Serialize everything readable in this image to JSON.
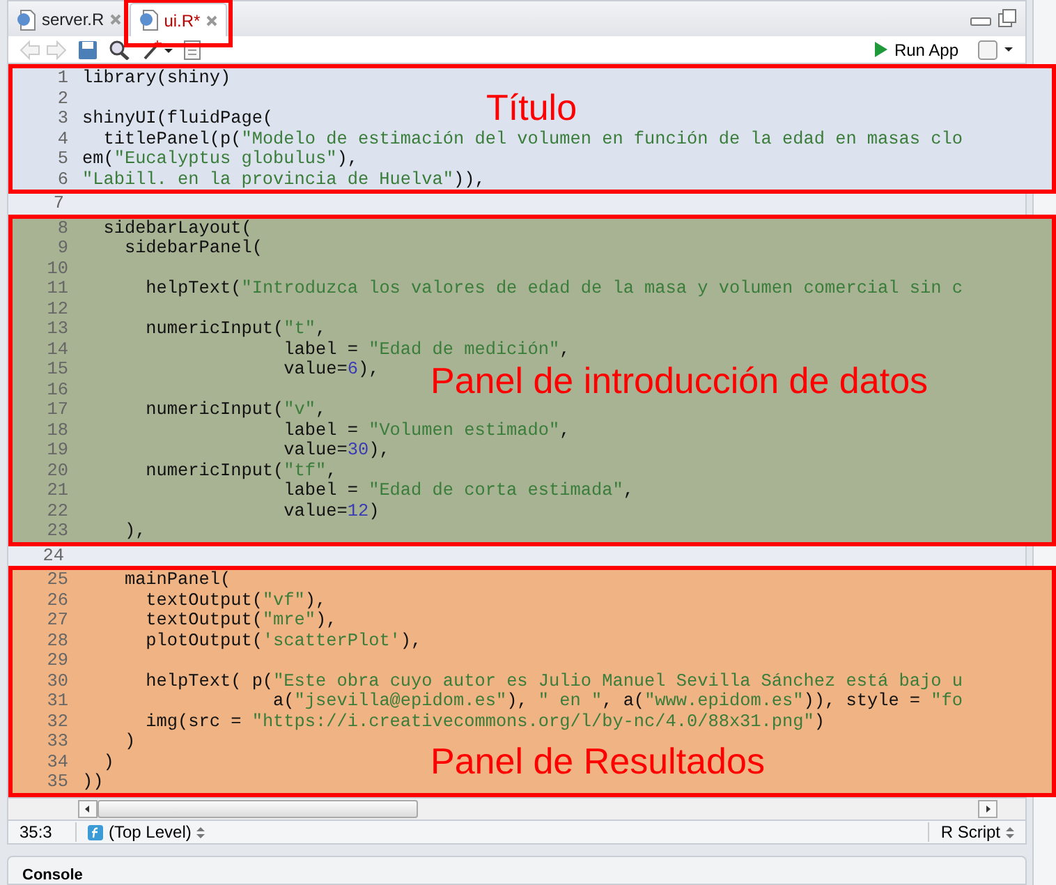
{
  "tabs": [
    {
      "label": "server.R",
      "selected": false,
      "highlighted": false
    },
    {
      "label": "ui.R*",
      "selected": true,
      "highlighted": true
    }
  ],
  "toolbar": {
    "run_button": "Run App"
  },
  "editor": {
    "blocks": [
      {
        "kind": "region",
        "label": "Título",
        "color": "#dce3ee",
        "lines": [
          {
            "number": "1",
            "code": "library(shiny)"
          },
          {
            "number": "2"
          },
          {
            "number": "3",
            "code": "shinyUI(fluidPage("
          },
          {
            "number": "4",
            "code": "  titlePanel(p(\"Modelo de estimación del volumen en función de la edad en masas clo"
          },
          {
            "number": "5",
            "code": "em(\"Eucalyptus globulus\"),"
          },
          {
            "number": "6",
            "code": "\"Labill. en la provincia de Huelva\")),"
          }
        ]
      },
      {
        "kind": "plain",
        "lines": [
          {
            "number": "7"
          }
        ]
      },
      {
        "kind": "region",
        "label": "Panel de introducción de datos",
        "color": "#a8b394",
        "lines": [
          {
            "number": "8",
            "code": "  sidebarLayout("
          },
          {
            "number": "9",
            "code": "    sidebarPanel("
          },
          {
            "number": "10"
          },
          {
            "number": "11",
            "code": "      helpText(\"Introduzca los valores de edad de la masa y volumen comercial sin c"
          },
          {
            "number": "12"
          },
          {
            "number": "13",
            "code": "      numericInput(\"t\","
          },
          {
            "number": "14",
            "code": "                   label = \"Edad de medición\","
          },
          {
            "number": "15",
            "code": "                   value=6),"
          },
          {
            "number": "16"
          },
          {
            "number": "17",
            "code": "      numericInput(\"v\","
          },
          {
            "number": "18",
            "code": "                   label = \"Volumen estimado\","
          },
          {
            "number": "19",
            "code": "                   value=30),"
          },
          {
            "number": "20",
            "code": "      numericInput(\"tf\","
          },
          {
            "number": "21",
            "code": "                   label = \"Edad de corta estimada\","
          },
          {
            "number": "22",
            "code": "                   value=12)"
          },
          {
            "number": "23",
            "code": "    ),"
          }
        ]
      },
      {
        "kind": "plain",
        "lines": [
          {
            "number": "24"
          }
        ]
      },
      {
        "kind": "region",
        "label": "Panel de Resultados",
        "color": "#f0b484",
        "lines": [
          {
            "number": "25",
            "code": "    mainPanel("
          },
          {
            "number": "26",
            "code": "      textOutput(\"vf\"),"
          },
          {
            "number": "27",
            "code": "      textOutput(\"mre\"),"
          },
          {
            "number": "28",
            "code": "      plotOutput('scatterPlot'),"
          },
          {
            "number": "29"
          },
          {
            "number": "30",
            "code": "      helpText( p(\"Este obra cuyo autor es Julio Manuel Sevilla Sánchez está bajo u"
          },
          {
            "number": "31",
            "code": "                  a(\"jsevilla@epidom.es\"), \" en \", a(\"www.epidom.es\")), style = \"fo"
          },
          {
            "number": "32",
            "code": "      img(src = \"https://i.creativecommons.org/l/by-nc/4.0/88x31.png\")"
          },
          {
            "number": "33",
            "code": "    )"
          },
          {
            "number": "34",
            "code": "  )"
          },
          {
            "number": "35",
            "code": "))"
          }
        ]
      }
    ]
  },
  "status_bar": {
    "position": "35:3",
    "scope": "(Top Level)",
    "file_type": "R Script"
  },
  "console": {
    "title": "Console"
  }
}
